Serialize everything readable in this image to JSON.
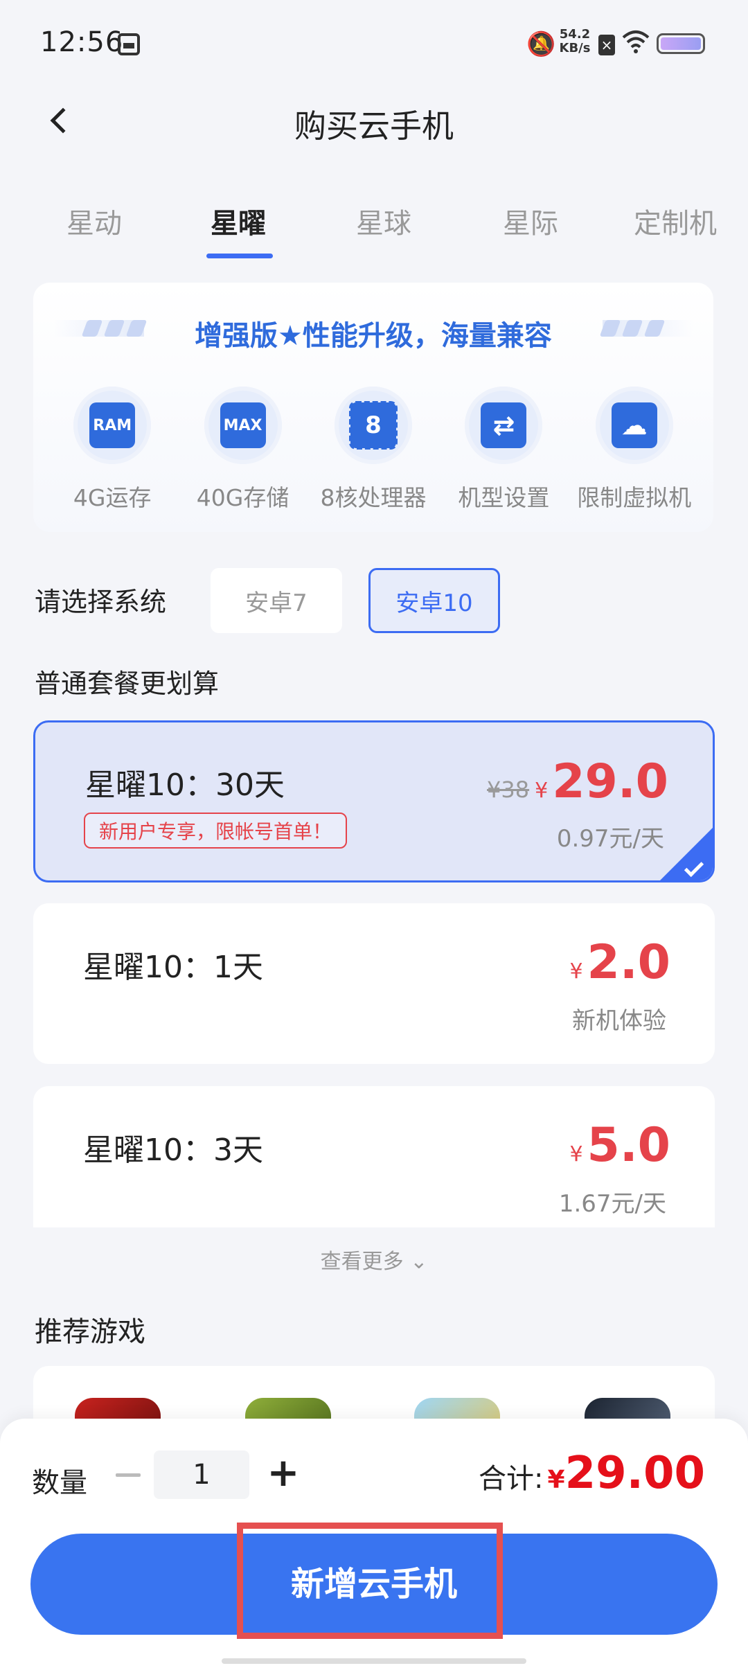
{
  "status_bar": {
    "time": "12:56",
    "speed_value": "54.2",
    "speed_unit": "KB/s"
  },
  "header": {
    "title": "购买云手机"
  },
  "tabs": [
    {
      "label": "星动",
      "active": false
    },
    {
      "label": "星曜",
      "active": true
    },
    {
      "label": "星球",
      "active": false
    },
    {
      "label": "星际",
      "active": false
    },
    {
      "label": "定制机",
      "active": false
    }
  ],
  "feature_card": {
    "banner": "增强版★性能升级，海量兼容",
    "items": [
      {
        "label": "4G运存",
        "icon": "ram-icon",
        "icon_text": "RAM"
      },
      {
        "label": "40G存储",
        "icon": "storage-icon",
        "icon_text": "MAX"
      },
      {
        "label": "8核处理器",
        "icon": "cpu-icon",
        "icon_text": "8"
      },
      {
        "label": "机型设置",
        "icon": "switch-model-icon",
        "icon_text": "⇄"
      },
      {
        "label": "限制虚拟机",
        "icon": "cloud-phone-icon",
        "icon_text": "☁"
      }
    ]
  },
  "system_select": {
    "label": "请选择系统",
    "options": [
      "安卓7",
      "安卓10"
    ],
    "selected": "安卓10"
  },
  "plans_section": {
    "title": "普通套餐更划算",
    "plans": [
      {
        "name": "星曜10：30天",
        "tag": "新用户专享，限帐号首单！",
        "old_price": "¥38",
        "currency": "¥",
        "price": "29.0",
        "sub": "0.97元/天",
        "selected": true
      },
      {
        "name": "星曜10：1天",
        "currency": "¥",
        "price": "2.0",
        "sub": "新机体验",
        "selected": false
      },
      {
        "name": "星曜10：3天",
        "currency": "¥",
        "price": "5.0",
        "sub": "1.67元/天",
        "selected": false
      }
    ],
    "see_more": "查看更多 ⌄"
  },
  "games": {
    "title": "推荐游戏"
  },
  "bottom_bar": {
    "qty_label": "数量",
    "qty_value": "1",
    "total_label": "合计:",
    "total_currency": "¥",
    "total_value": "29.00",
    "submit_label": "新增云手机"
  },
  "colors": {
    "accent": "#3c6cf3",
    "price_red": "#e5434a",
    "highlight": "#e55050"
  }
}
